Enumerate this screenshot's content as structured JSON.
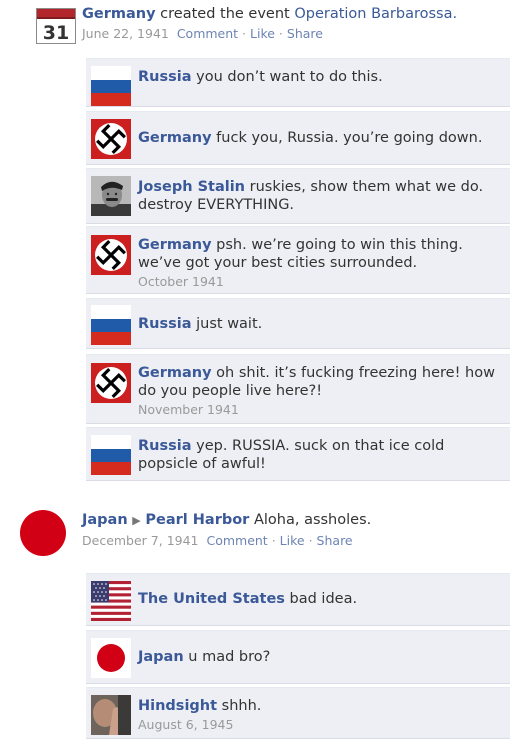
{
  "post1": {
    "actor": "Germany",
    "text": "created the event",
    "event": "Operation Barbarossa.",
    "date": "June 22, 1941",
    "comment": "Comment",
    "like": "Like",
    "share": "Share",
    "icon_number": "31",
    "sep": "·"
  },
  "comments1": [
    {
      "author": "Russia",
      "text": "you don’t want to do this.",
      "date": ""
    },
    {
      "author": "Germany",
      "text": "fuck you, Russia. you’re going down.",
      "date": ""
    },
    {
      "author": "Joseph Stalin",
      "text": "ruskies, show them what we do. destroy EVERYTHING.",
      "date": ""
    },
    {
      "author": "Germany",
      "text": "psh. we’re going to win this thing. we’ve got your best cities surrounded.",
      "date": "October 1941"
    },
    {
      "author": "Russia",
      "text": "just wait.",
      "date": ""
    },
    {
      "author": "Germany",
      "text": "oh shit. it’s fucking freezing here! how do you people live here?!",
      "date": "November 1941"
    },
    {
      "author": "Russia",
      "text": "yep. RUSSIA. suck on that ice cold popsicle of awful!",
      "date": ""
    }
  ],
  "post2": {
    "actor": "Japan",
    "arrow": "▶",
    "target": "Pearl Harbor",
    "text": "Aloha, assholes.",
    "date": "December 7, 1941",
    "comment": "Comment",
    "like": "Like",
    "share": "Share",
    "sep": "·"
  },
  "comments2": [
    {
      "author": "The United States",
      "text": "bad idea.",
      "date": ""
    },
    {
      "author": "Japan",
      "text": "u mad bro?",
      "date": ""
    },
    {
      "author": "Hindsight",
      "text": "shhh.",
      "date": "August 6, 1945"
    }
  ]
}
